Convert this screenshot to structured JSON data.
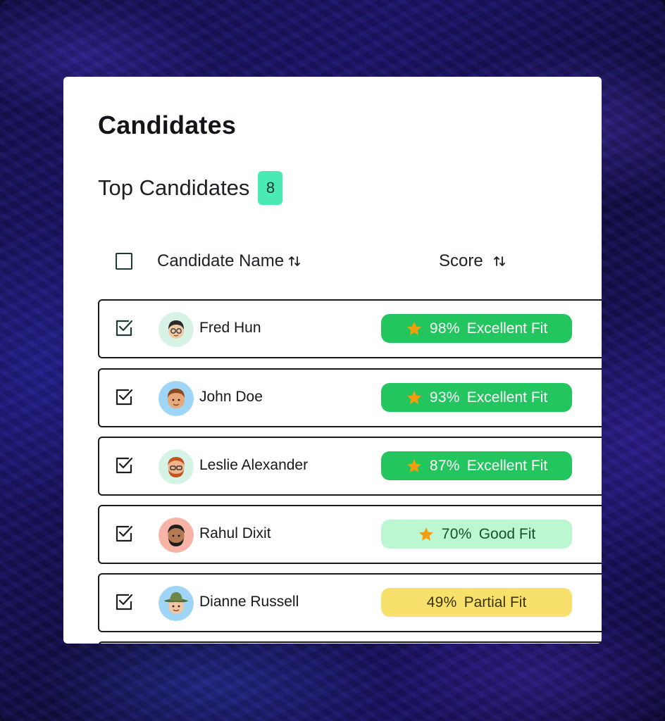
{
  "page": {
    "title": "Candidates",
    "subtitle": "Top Candidates",
    "count": "8"
  },
  "table": {
    "header": {
      "name_label": "Candidate Name",
      "score_label": "Score"
    },
    "rows": [
      {
        "name": "Fred Hun",
        "score": "98%",
        "fit": "Excellent Fit",
        "level": "excellent",
        "checked": true,
        "avatar_bg": "#d7f3e6"
      },
      {
        "name": "John Doe",
        "score": "93%",
        "fit": "Excellent Fit",
        "level": "excellent",
        "checked": true,
        "avatar_bg": "#9fd6f7"
      },
      {
        "name": "Leslie Alexander",
        "score": "87%",
        "fit": "Excellent Fit",
        "level": "excellent",
        "checked": true,
        "avatar_bg": "#d7f3e6"
      },
      {
        "name": "Rahul Dixit",
        "score": "70%",
        "fit": "Good Fit",
        "level": "good",
        "checked": true,
        "avatar_bg": "#f6b3a6"
      },
      {
        "name": "Dianne Russell",
        "score": "49%",
        "fit": "Partial Fit",
        "level": "partial",
        "checked": true,
        "avatar_bg": "#9fd6f7"
      }
    ]
  },
  "colors": {
    "excellent_bg": "#22c55e",
    "excellent_text": "#ffffff",
    "good_bg": "#bbf7d0",
    "good_text": "#14532d",
    "partial_bg": "#f7e06b",
    "partial_text": "#3b3400",
    "star": "#f59e0b",
    "badge_bg": "#49eab3"
  }
}
